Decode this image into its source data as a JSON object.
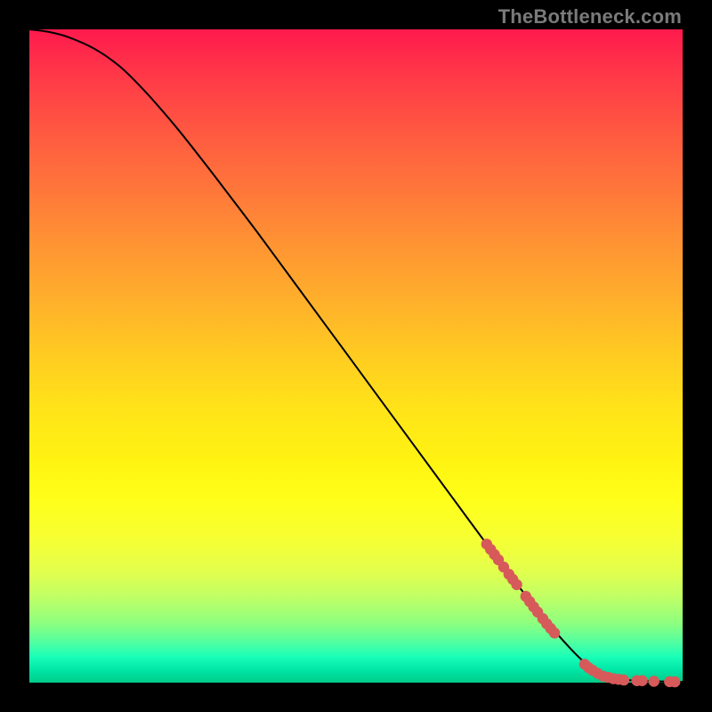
{
  "watermark": "TheBottleneck.com",
  "chart_data": {
    "type": "line",
    "title": "",
    "xlabel": "",
    "ylabel": "",
    "xlim": [
      0,
      100
    ],
    "ylim": [
      0,
      100
    ],
    "curve": {
      "name": "bottleneck-curve",
      "points": [
        {
          "x": 0,
          "y": 100
        },
        {
          "x": 3,
          "y": 99.6
        },
        {
          "x": 6,
          "y": 98.8
        },
        {
          "x": 10,
          "y": 97.0
        },
        {
          "x": 14,
          "y": 94.2
        },
        {
          "x": 18,
          "y": 90.2
        },
        {
          "x": 22,
          "y": 85.6
        },
        {
          "x": 26,
          "y": 80.6
        },
        {
          "x": 30,
          "y": 75.4
        },
        {
          "x": 35,
          "y": 68.8
        },
        {
          "x": 40,
          "y": 62.0
        },
        {
          "x": 45,
          "y": 55.2
        },
        {
          "x": 50,
          "y": 48.4
        },
        {
          "x": 55,
          "y": 41.6
        },
        {
          "x": 60,
          "y": 34.8
        },
        {
          "x": 65,
          "y": 28.0
        },
        {
          "x": 70,
          "y": 21.2
        },
        {
          "x": 75,
          "y": 14.6
        },
        {
          "x": 80,
          "y": 8.4
        },
        {
          "x": 84,
          "y": 4.0
        },
        {
          "x": 87,
          "y": 1.6
        },
        {
          "x": 90,
          "y": 0.6
        },
        {
          "x": 93,
          "y": 0.3
        },
        {
          "x": 96,
          "y": 0.2
        },
        {
          "x": 100,
          "y": 0.1
        }
      ]
    },
    "scatter": {
      "name": "highlighted-segment",
      "points": [
        {
          "x": 70.0,
          "y": 21.2
        },
        {
          "x": 70.6,
          "y": 20.4
        },
        {
          "x": 71.2,
          "y": 19.6
        },
        {
          "x": 71.8,
          "y": 18.8
        },
        {
          "x": 72.6,
          "y": 17.7
        },
        {
          "x": 73.4,
          "y": 16.6
        },
        {
          "x": 74.0,
          "y": 15.8
        },
        {
          "x": 74.6,
          "y": 15.0
        },
        {
          "x": 76.0,
          "y": 13.2
        },
        {
          "x": 76.6,
          "y": 12.4
        },
        {
          "x": 77.2,
          "y": 11.6
        },
        {
          "x": 77.8,
          "y": 10.8
        },
        {
          "x": 78.6,
          "y": 9.8
        },
        {
          "x": 79.2,
          "y": 9.0
        },
        {
          "x": 79.8,
          "y": 8.3
        },
        {
          "x": 80.4,
          "y": 7.6
        },
        {
          "x": 85.0,
          "y": 2.8
        },
        {
          "x": 85.6,
          "y": 2.3
        },
        {
          "x": 86.2,
          "y": 1.9
        },
        {
          "x": 87.0,
          "y": 1.4
        },
        {
          "x": 87.8,
          "y": 1.0
        },
        {
          "x": 88.6,
          "y": 0.8
        },
        {
          "x": 89.4,
          "y": 0.6
        },
        {
          "x": 90.2,
          "y": 0.5
        },
        {
          "x": 91.0,
          "y": 0.4
        },
        {
          "x": 93.0,
          "y": 0.3
        },
        {
          "x": 93.8,
          "y": 0.3
        },
        {
          "x": 95.6,
          "y": 0.2
        },
        {
          "x": 98.0,
          "y": 0.15
        },
        {
          "x": 98.8,
          "y": 0.12
        }
      ]
    }
  }
}
